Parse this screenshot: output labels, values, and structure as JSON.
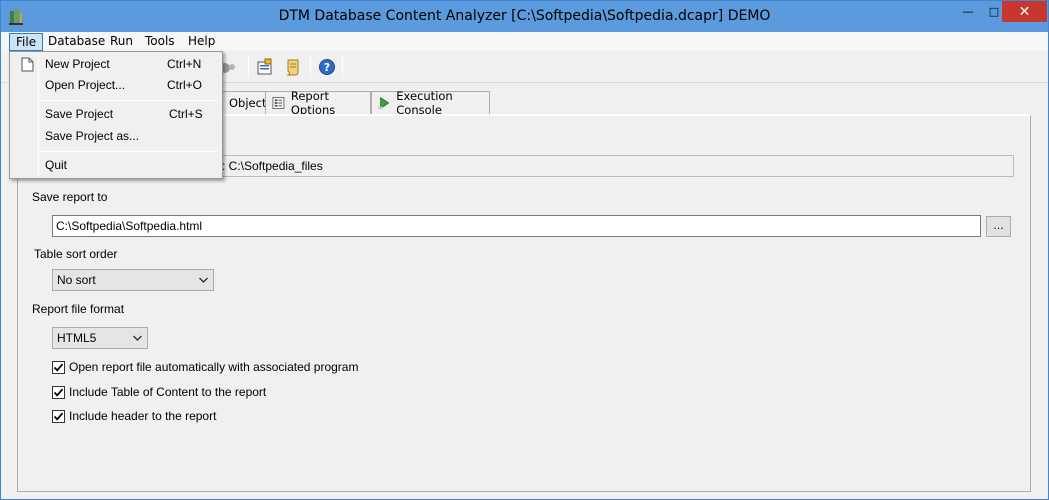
{
  "window": {
    "title": "DTM Database Content Analyzer [C:\\Softpedia\\Softpedia.dcapr] DEMO",
    "minimize_glyph": "—",
    "maximize_glyph": "□",
    "close_glyph": "✕"
  },
  "menubar": {
    "items": [
      {
        "label": "File"
      },
      {
        "label": "Database"
      },
      {
        "label": "Run"
      },
      {
        "label": "Tools"
      },
      {
        "label": "Help"
      }
    ]
  },
  "file_menu": {
    "items": [
      {
        "label": "New Project",
        "shortcut": "Ctrl+N",
        "icon": "new-document-icon"
      },
      {
        "label": "Open Project...",
        "shortcut": "Ctrl+O"
      },
      {
        "label": "Save Project",
        "shortcut": "Ctrl+S"
      },
      {
        "label": "Save Project as...",
        "shortcut": ""
      },
      {
        "label": "Quit",
        "shortcut": ""
      }
    ]
  },
  "toolbar": {
    "icons": [
      "run-icon",
      "settings-icon",
      "script-icon",
      "help-icon"
    ]
  },
  "tabs": [
    {
      "label": "Objects"
    },
    {
      "label": "Report Options",
      "icon": "report-options-icon"
    },
    {
      "label": "Execution Console",
      "icon": "console-play-icon"
    }
  ],
  "report": {
    "folder_text": "er : C:\\Softpedia_files",
    "save_label": "Save report to",
    "save_path": "C:\\Softpedia\\Softpedia.html",
    "browse_label": "...",
    "sort_label": "Table sort order",
    "sort_value": "No sort",
    "format_label": "Report file format",
    "format_value": "HTML5",
    "checkboxes": [
      {
        "label": "Open report file automatically with associated program",
        "checked": true
      },
      {
        "label": "Include Table of Content to the report",
        "checked": true
      },
      {
        "label": "Include header to the report",
        "checked": true
      }
    ]
  },
  "colors": {
    "titlebar": "#5b9bdd",
    "close_button": "#c7372f",
    "menu_highlight": "#cce4f7"
  }
}
